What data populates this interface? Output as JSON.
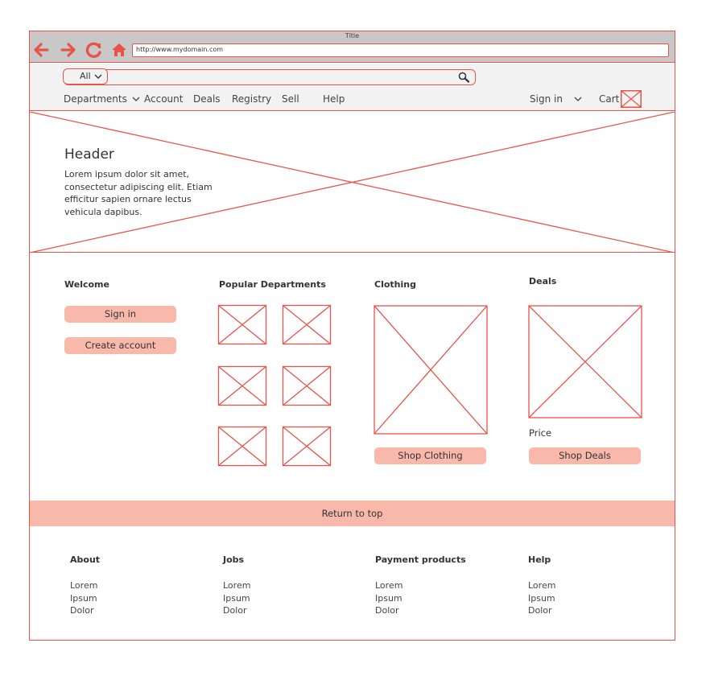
{
  "browser": {
    "window_title": "Title",
    "url": "http://www.mydomain.com",
    "back_icon": "arrow-left-icon",
    "forward_icon": "arrow-right-icon",
    "reload_icon": "reload-icon",
    "home_icon": "home-icon"
  },
  "search": {
    "category": "All",
    "icon": "search-icon"
  },
  "nav": {
    "departments": "Departments",
    "account": "Account",
    "deals": "Deals",
    "registry": "Registry",
    "sell": "Sell",
    "help": "Help",
    "sign_in": "Sign in",
    "cart": "Cart"
  },
  "hero": {
    "title": "Header",
    "text": "Lorem ipsum dolor sit amet, consectetur adipiscing elit. Etiam efficitur sapien ornare lectus vehicula dapibus."
  },
  "welcome": {
    "title": "Welcome",
    "sign_in": "Sign in",
    "create_account": "Create account"
  },
  "popular": {
    "title": "Popular Departments"
  },
  "clothing": {
    "title": "Clothing",
    "button": "Shop Clothing"
  },
  "deals": {
    "title": "Deals",
    "price": "Price",
    "button": "Shop Deals"
  },
  "return_top": "Return to top",
  "footer": [
    {
      "title": "About",
      "links": [
        "Lorem",
        "Ipsum",
        "Dolor"
      ]
    },
    {
      "title": "Jobs",
      "links": [
        "Lorem",
        "Ipsum",
        "Dolor"
      ]
    },
    {
      "title": "Payment products",
      "links": [
        "Lorem",
        "Ipsum",
        "Dolor"
      ]
    },
    {
      "title": "Help",
      "links": [
        "Lorem",
        "Ipsum",
        "Dolor"
      ]
    }
  ],
  "colors": {
    "accent": "#e8534a",
    "button": "#f9b9aa",
    "toolbar": "#c8c8c8",
    "navbar": "#f2f2f2"
  }
}
